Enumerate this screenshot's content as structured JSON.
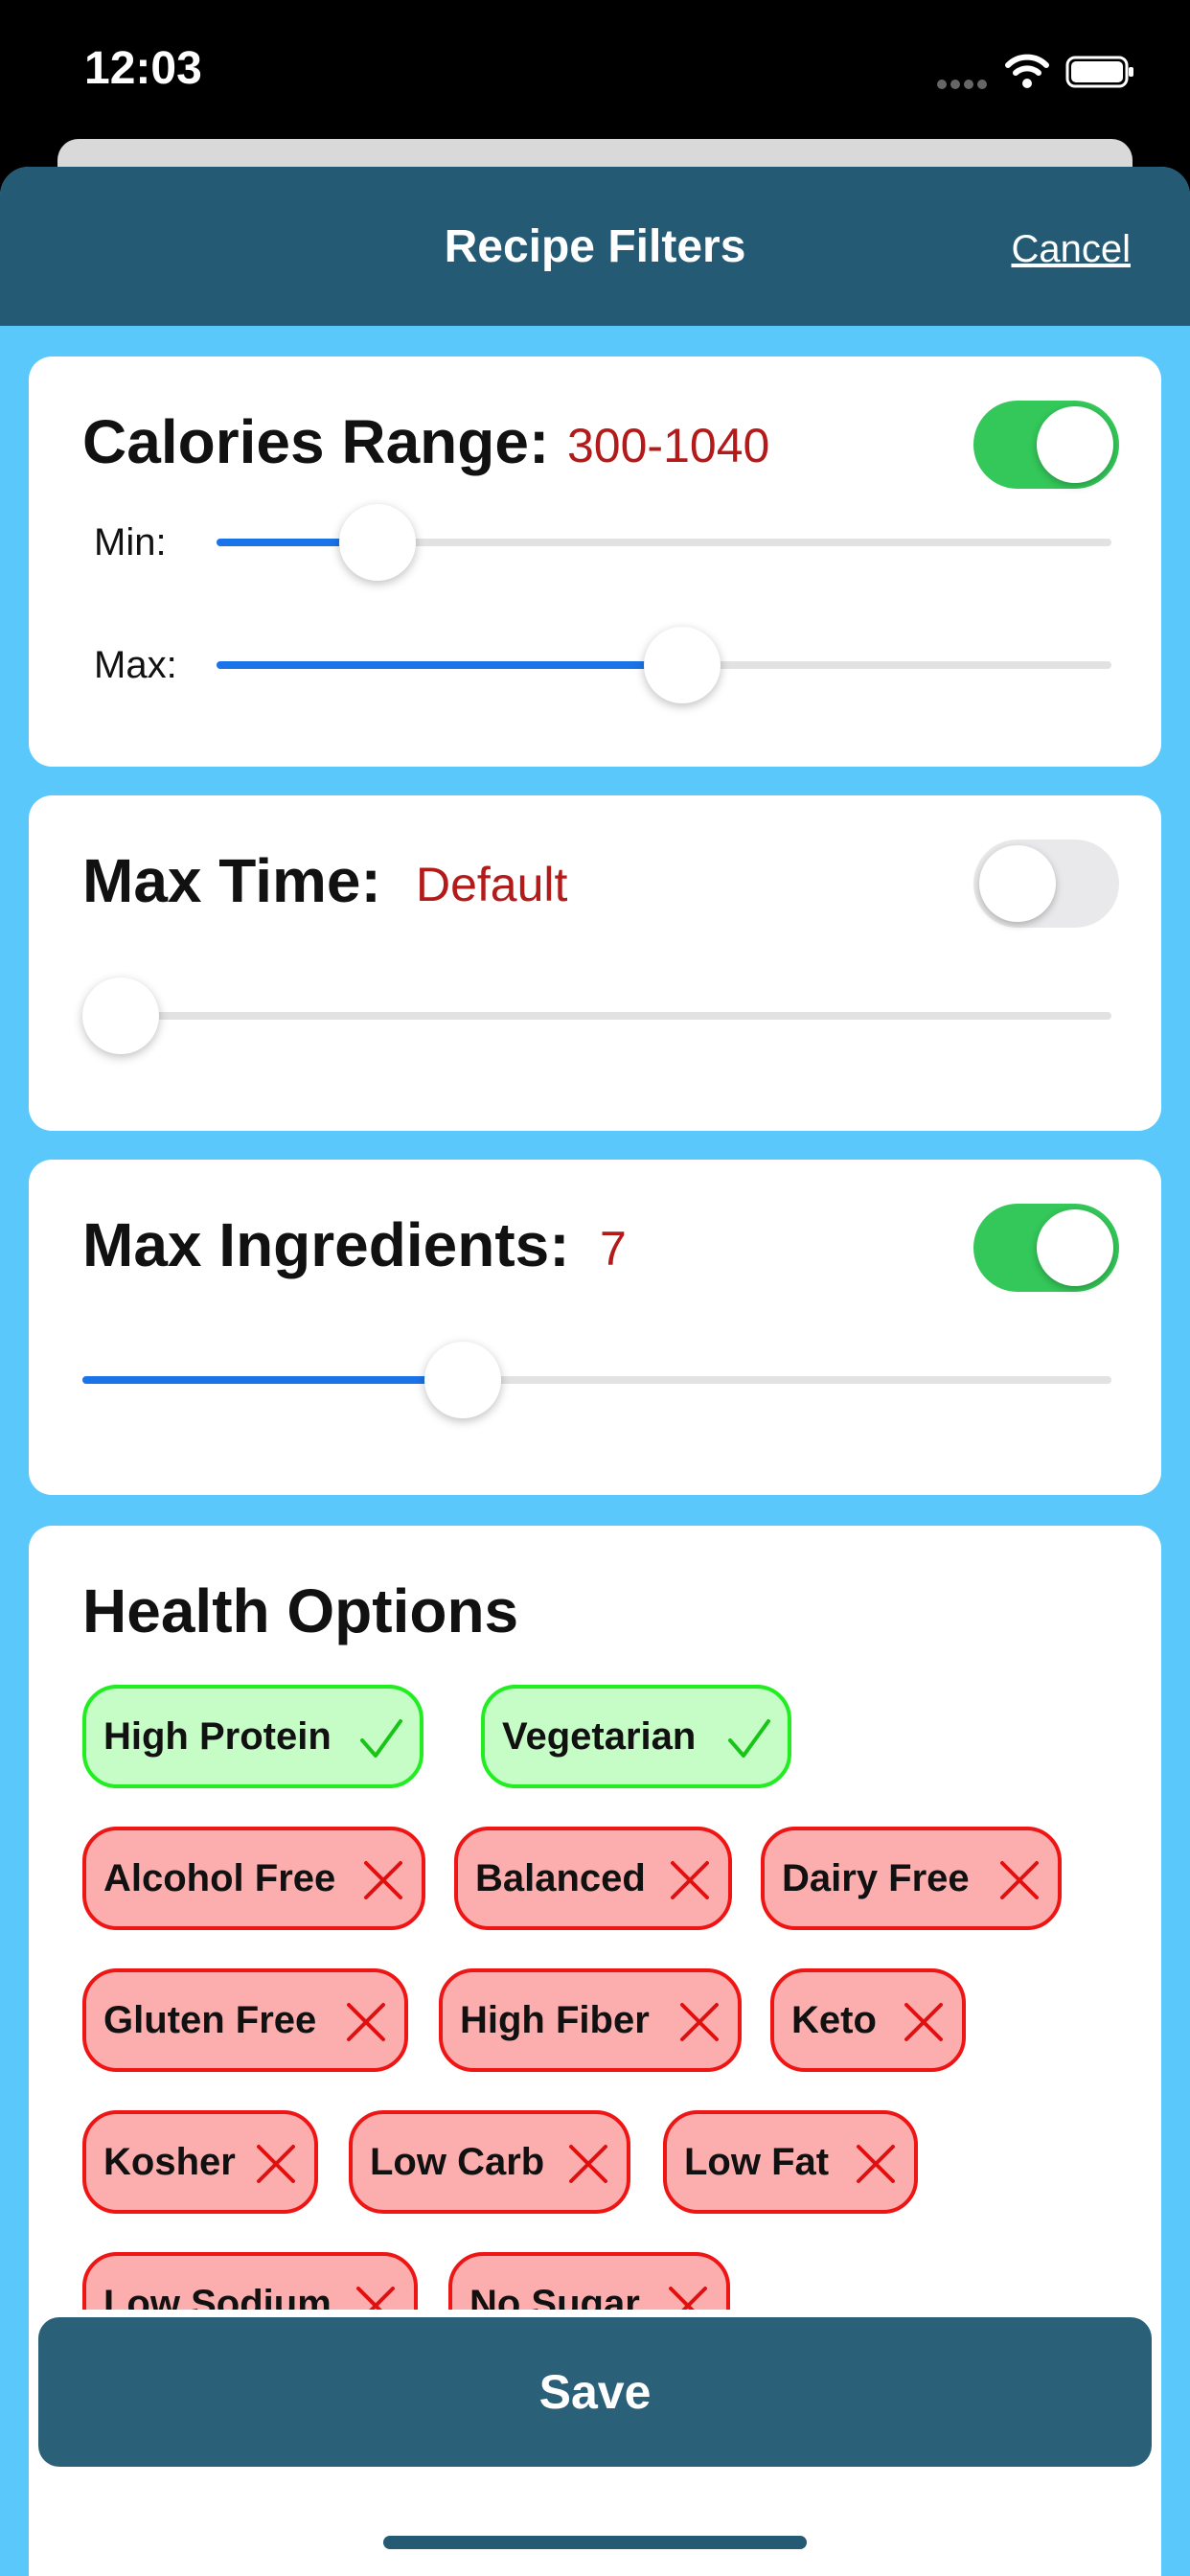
{
  "status_bar": {
    "time": "12:03"
  },
  "nav": {
    "title": "Recipe Filters",
    "cancel_label": "Cancel"
  },
  "calories": {
    "title": "Calories Range:",
    "value": "300-1040",
    "toggle_on": true,
    "min_label": "Min:",
    "max_label": "Max:",
    "min_level": 0.18,
    "max_level": 0.52
  },
  "max_time": {
    "title": "Max Time:",
    "value": "Default",
    "toggle_on": false,
    "level": 0.0
  },
  "max_ingredients": {
    "title": "Max Ingredients:",
    "value": "7",
    "toggle_on": true,
    "level": 0.37
  },
  "health": {
    "title": "Health Options",
    "chips": [
      {
        "label": "High Protein",
        "selected": true
      },
      {
        "label": "Vegetarian",
        "selected": true
      },
      {
        "label": "Alcohol Free",
        "selected": false
      },
      {
        "label": "Balanced",
        "selected": false
      },
      {
        "label": "Dairy Free",
        "selected": false
      },
      {
        "label": "Gluten Free",
        "selected": false
      },
      {
        "label": "High Fiber",
        "selected": false
      },
      {
        "label": "Keto",
        "selected": false
      },
      {
        "label": "Kosher",
        "selected": false
      },
      {
        "label": "Low Carb",
        "selected": false
      },
      {
        "label": "Low Fat",
        "selected": false
      },
      {
        "label": "Low Sodium",
        "selected": false
      },
      {
        "label": "No Sugar",
        "selected": false
      }
    ]
  },
  "save_label": "Save",
  "colors": {
    "nav_bg": "#245a74",
    "sheet_bg": "#5ac8fa",
    "toggle_on": "#34c759",
    "slider_fill": "#1b73e8",
    "value_red": "#b31b1b"
  }
}
